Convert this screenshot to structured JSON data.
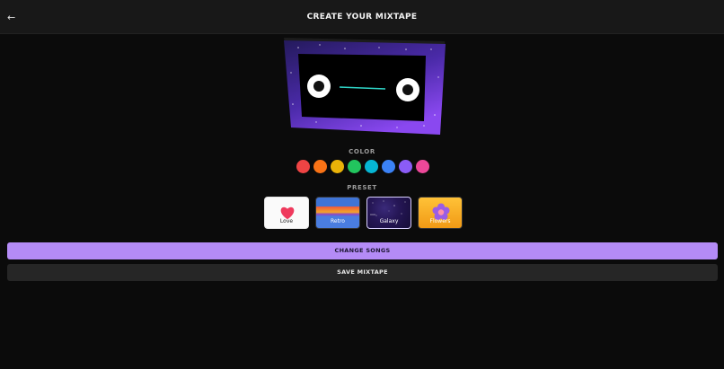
{
  "header": {
    "back_icon": "back-arrow-icon",
    "back_glyph": "←",
    "title": "CREATE YOUR MIXTAPE"
  },
  "cassette": {
    "theme": "Galaxy",
    "colors": {
      "body_top": "#2b1f6a",
      "body_bottom": "#7a3ee0",
      "window": "#000000",
      "tape": "#2fd6c8",
      "reel": "#ffffff"
    }
  },
  "color_section": {
    "label": "COLOR",
    "swatches": [
      {
        "name": "red",
        "color": "#ef4444"
      },
      {
        "name": "orange",
        "color": "#f97316"
      },
      {
        "name": "yellow",
        "color": "#eab308"
      },
      {
        "name": "green",
        "color": "#22c55e"
      },
      {
        "name": "cyan",
        "color": "#06b6d4"
      },
      {
        "name": "blue",
        "color": "#3b82f6"
      },
      {
        "name": "purple",
        "color": "#8b5cf6"
      },
      {
        "name": "pink",
        "color": "#ec4899"
      }
    ]
  },
  "preset_section": {
    "label": "PRESET",
    "presets": [
      {
        "label": "Love",
        "icon": "heart-icon"
      },
      {
        "label": "Retro",
        "icon": "sunset-stripes"
      },
      {
        "label": "Galaxy",
        "icon": "stars",
        "selected": true
      },
      {
        "label": "Flowers",
        "icon": "flower-icon"
      }
    ]
  },
  "actions": {
    "change_songs": "CHANGE SONGS",
    "save_mixtape": "SAVE MIXTAPE"
  }
}
